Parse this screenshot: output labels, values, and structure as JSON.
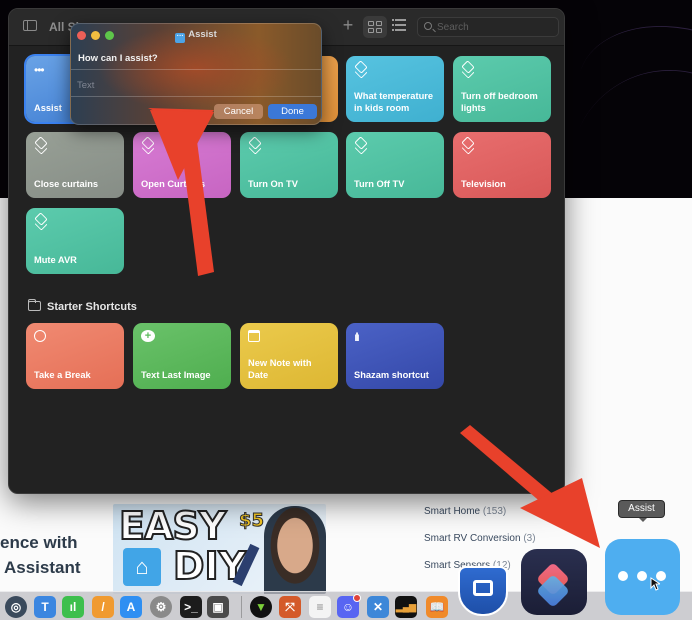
{
  "window": {
    "title": "All Shortcuts",
    "search_placeholder": "Search",
    "view_modes": [
      "grid",
      "list"
    ]
  },
  "dialog": {
    "app_title": "Assist",
    "prompt": "How can I assist?",
    "input_placeholder": "Text",
    "input_value": "",
    "cancel_label": "Cancel",
    "done_label": "Done"
  },
  "shortcuts": [
    {
      "label": "Assist",
      "icon": "ellipsis-icon",
      "color": "#4e8fdc",
      "selected": true
    },
    {
      "label": "What temperature in kids room",
      "icon": "layers-icon",
      "color": "#4bb9d8"
    },
    {
      "label": "Turn off bedroom lights",
      "icon": "layers-icon",
      "color": "#52c1a4"
    },
    {
      "label": "Close curtains",
      "icon": "layers-icon",
      "color": "#8d958d"
    },
    {
      "label": "Open Curtains",
      "icon": "layers-icon",
      "color": "#cd6fc9"
    },
    {
      "label": "Turn On TV",
      "icon": "layers-icon",
      "color": "#52c1a4"
    },
    {
      "label": "Turn Off TV",
      "icon": "layers-icon",
      "color": "#52c1a4"
    },
    {
      "label": "Television",
      "icon": "layers-icon",
      "color": "#e06464"
    },
    {
      "label": "Mute AVR",
      "icon": "layers-icon",
      "color": "#52c1a4"
    }
  ],
  "starter_section": {
    "title": "Starter Shortcuts",
    "items": [
      {
        "label": "Take a Break",
        "icon": "timer-icon",
        "color": "#ec7a62"
      },
      {
        "label": "Text Last Image",
        "icon": "message-plus-icon",
        "color": "#5cba5c"
      },
      {
        "label": "New Note with Date",
        "icon": "note-plus-icon",
        "color": "#e5c240"
      },
      {
        "label": "Shazam shortcut",
        "icon": "waveform-icon",
        "color": "#3f55b8"
      }
    ]
  },
  "webpage": {
    "heading_line1": "ence with",
    "heading_line2": "Assistant",
    "thumbnail": {
      "text_easy": "EASY",
      "text_diy": "DIY",
      "price": "$5"
    },
    "categories": [
      {
        "name": "Smart Home",
        "count": "(153)"
      },
      {
        "name": "Smart RV Conversion",
        "count": "(3)"
      },
      {
        "name": "Smart Sensors",
        "count": "(12)"
      }
    ]
  },
  "dock": {
    "tooltip": "Assist",
    "items": [
      "quicktime-icon",
      "keynote-icon",
      "numbers-icon",
      "pages-icon",
      "app-store-icon",
      "system-preferences-icon",
      "terminal-icon",
      "screenshot-icon",
      "vpn-icon",
      "remote-desktop-icon",
      "textedit-icon",
      "discord-icon",
      "xcode-tools-icon",
      "audio-meter-icon",
      "books-icon",
      "fortinet-icon",
      "shortcuts-icon",
      "assist-icon"
    ]
  }
}
